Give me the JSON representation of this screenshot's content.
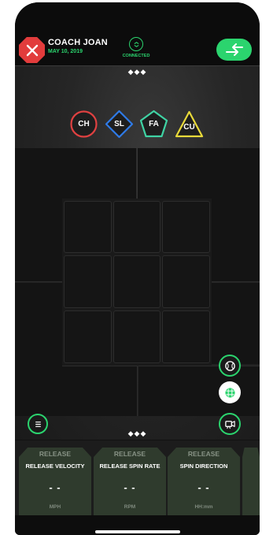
{
  "header": {
    "coach_name": "COACH JOAN",
    "date": "MAY 10, 2019",
    "connection_status": "CONNECTED",
    "close_icon": "close-x-icon",
    "connection_icon": "link-icon",
    "swap_icon": "swap-arrows-icon"
  },
  "top_handle": "◆◆◆",
  "pitch_types": [
    {
      "label": "CH",
      "shape": "circle",
      "color": "#e04141"
    },
    {
      "label": "SL",
      "shape": "diamond",
      "color": "#2f7be8"
    },
    {
      "label": "FA",
      "shape": "pentagon",
      "color": "#3fd3a4"
    },
    {
      "label": "CU",
      "shape": "triangle",
      "color": "#e8d93a"
    }
  ],
  "side_buttons": [
    {
      "name": "baseball-icon",
      "style": "outline"
    },
    {
      "name": "grid-icon",
      "style": "filled"
    },
    {
      "name": "video-icon",
      "style": "outline"
    },
    {
      "name": "menu-icon",
      "style": "outline"
    }
  ],
  "bottom_handle": "◆◆◆",
  "metrics": [
    {
      "category": "RELEASE",
      "title": "RELEASE VELOCITY",
      "value": "- -",
      "unit": "MPH"
    },
    {
      "category": "RELEASE",
      "title": "RELEASE SPIN RATE",
      "value": "- -",
      "unit": "RPM"
    },
    {
      "category": "RELEASE",
      "title": "SPIN DIRECTION",
      "value": "- -",
      "unit": "HH:mm"
    }
  ],
  "colors": {
    "accent_green": "#2bd46e",
    "close_red": "#e23c3c",
    "card_bg": "#2f3b2d"
  }
}
